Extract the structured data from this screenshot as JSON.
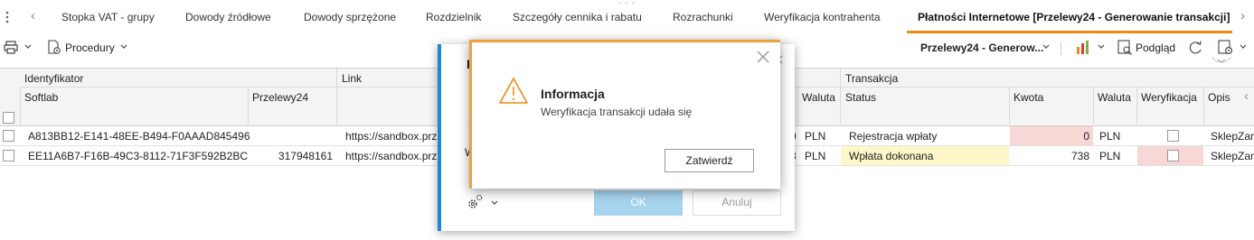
{
  "tabs": {
    "menu_icon": "vertical-dots-icon",
    "items": [
      {
        "label": "Stopka VAT - grupy"
      },
      {
        "label": "Dowody źródłowe"
      },
      {
        "label": "Dowody sprzężone"
      },
      {
        "label": "Rozdzielnik"
      },
      {
        "label": "Szczegóły cennika i rabatu"
      },
      {
        "label": "Rozrachunki"
      },
      {
        "label": "Weryfikacja kontrahenta"
      },
      {
        "label": "Płatności Internetowe [Przelewy24 - Generowanie transakcji]"
      }
    ],
    "active_color": "#ee8a13"
  },
  "toolbar": {
    "procedures_label": "Procedury",
    "selector_label": "Przelewy24 - Generow...",
    "preview_label": "Podgląd"
  },
  "grid": {
    "groups": {
      "identifier": "Identyfikator",
      "link": "Link",
      "transaction": "Transakcja"
    },
    "columns": {
      "softlab": "Softlab",
      "przelewy24": "Przelewy24",
      "currency_left": "Waluta",
      "status": "Status",
      "amount": "Kwota",
      "currency": "Waluta",
      "verification": "Weryfikacja",
      "description": "Opis"
    },
    "rows": [
      {
        "softlab": "A813BB12-E141-48EE-B494-F0AAAD845496",
        "przelewy24": "",
        "link": "https://sandbox.prz",
        "left_digit": "0",
        "currency_left": "PLN",
        "status": "Rejestracja wpłaty",
        "amount": "0",
        "currency": "PLN",
        "description": "SklepZam"
      },
      {
        "softlab": "EE11A6B7-F16B-49C3-8112-71F3F592B2BC",
        "przelewy24": "317948161",
        "link": "https://sandbox.prz",
        "left_digit": "3",
        "currency_left": "PLN",
        "status": "Wpłata dokonana",
        "amount": "738",
        "currency": "PLN",
        "description": "SklepZam"
      }
    ],
    "colors": {
      "amount_highlight": "#f8d7d7",
      "status_highlight": "#fdf7c9",
      "verification_highlight": "#f8d7d7"
    }
  },
  "back_dialog": {
    "title_fragment": "P",
    "fragment_h": "H",
    "fragment_w": "W",
    "ok_label": "OK",
    "cancel_label": "Anuluj",
    "accent": "#1e88d6"
  },
  "info_dialog": {
    "title": "Informacja",
    "message": "Weryfikacja transakcji udała się",
    "confirm_label": "Zatwierdź",
    "accent": "#f0a23a"
  }
}
